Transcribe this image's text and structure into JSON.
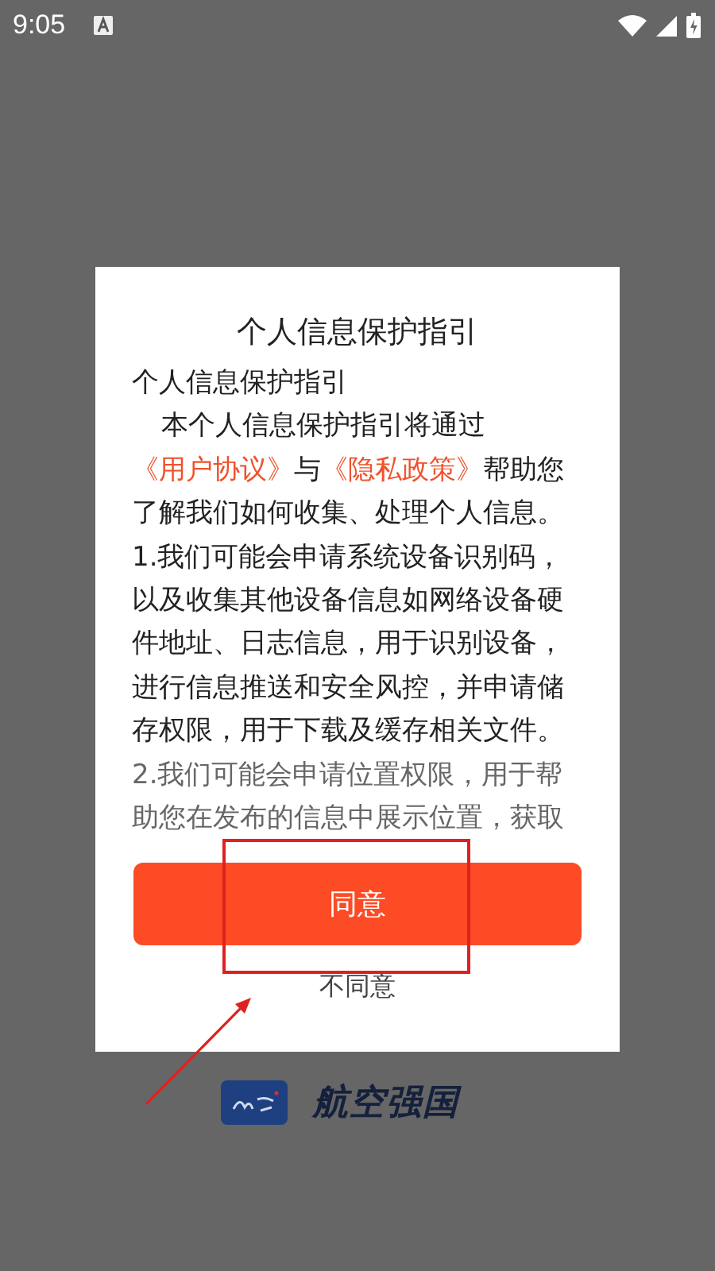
{
  "status_bar": {
    "time": "9:05"
  },
  "dialog": {
    "title": "个人信息保护指引",
    "heading": "个人信息保护指引",
    "paragraphs": [
      {
        "kind": "mixed",
        "segments": [
          {
            "kind": "text",
            "text": "本个人信息保护指引将通过"
          },
          {
            "kind": "link",
            "text": "《用户协议》"
          },
          {
            "kind": "text",
            "text": "与"
          },
          {
            "kind": "link",
            "text": "《隐私政策》"
          },
          {
            "kind": "text",
            "text": "帮助您了解我们如何收集、处理个人信息。"
          }
        ]
      },
      {
        "kind": "plain",
        "text": "1.我们可能会申请系统设备识别码，以及收集其他设备信息如网络设备硬件地址、日志信息，用于识别设备，进行信息推送和安全风控，并申请储存权限，用于下载及缓存相关文件。"
      },
      {
        "kind": "plain",
        "text": "2.我们可能会申请位置权限，用于帮助您在发布的信息中展示位置，获取"
      }
    ],
    "agree_button": "同意",
    "decline_link": "不同意"
  },
  "brand": {
    "name": "航空强国"
  },
  "annotation": {
    "highlight_box": true,
    "arrow": true
  }
}
